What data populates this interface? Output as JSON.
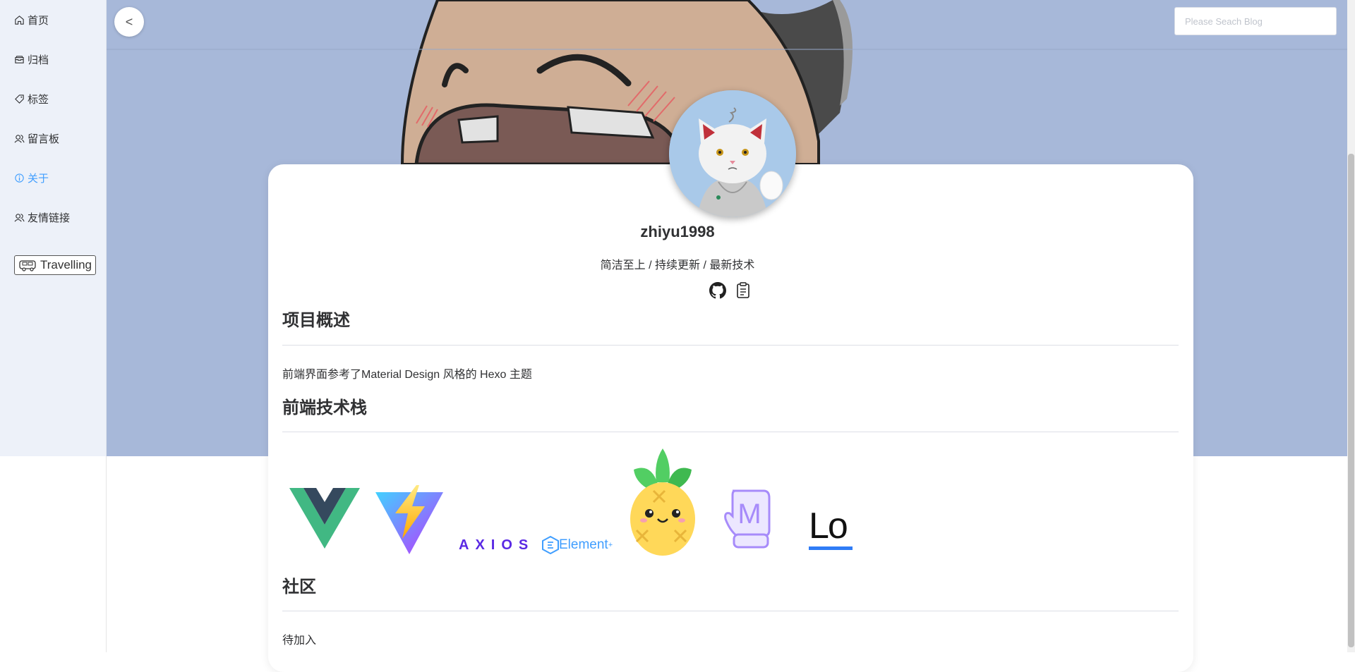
{
  "sidebar": {
    "items": [
      {
        "label": "首页",
        "icon": "home-icon"
      },
      {
        "label": "归档",
        "icon": "box-icon"
      },
      {
        "label": "标签",
        "icon": "tag-icon"
      },
      {
        "label": "留言板",
        "icon": "users-icon"
      },
      {
        "label": "关于",
        "icon": "info-icon",
        "active": true
      },
      {
        "label": "友情链接",
        "icon": "users-icon"
      }
    ],
    "badge_label": "Travelling"
  },
  "header": {
    "search_placeholder": "Please Seach Blog",
    "back_label": "<"
  },
  "profile": {
    "username": "zhiyu1998",
    "motto": "简洁至上 / 持续更新 / 最新技术"
  },
  "sections": [
    {
      "title": "项目概述",
      "text": "前端界面参考了Material Design 风格的 Hexo 主题"
    },
    {
      "title": "前端技术栈",
      "logos": [
        "vue-logo",
        "vite-logo",
        "axios-logo",
        "element-plus-logo",
        "pinia-logo",
        "mitten-logo",
        "lo-logo"
      ]
    },
    {
      "title": "社区",
      "text": "待加入"
    }
  ],
  "logo_text": {
    "axios": "AXIOS",
    "element": "Element",
    "element_sup": "+",
    "mitten": "M",
    "lo": "Lo"
  },
  "colors": {
    "accent": "#409eff",
    "hero_bg": "#a7b8d9",
    "sidebar_bg": "#edf1f9"
  }
}
